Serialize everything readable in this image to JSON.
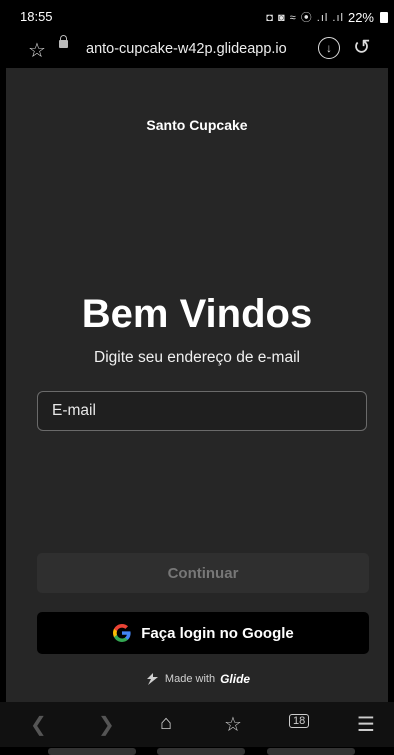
{
  "status": {
    "time": "18:55",
    "battery": "22%",
    "indicator_icons": "◘ ◙ ≈ ⦿ .ıl .ıl"
  },
  "browser": {
    "url": "anto-cupcake-w42p.glideapp.io"
  },
  "app": {
    "brand": "Santo Cupcake",
    "welcome": "Bem Vindos",
    "subtitle": "Digite seu endereço de e-mail",
    "email_placeholder": "E-mail",
    "continue_label": "Continuar",
    "google_label": "Faça login no Google",
    "made_with_prefix": "Made with",
    "made_with_brand": "Glide"
  },
  "nav": {
    "tabs_count": "18"
  },
  "colors": {
    "app_bg": "#262626",
    "google_btn_bg": "#000000",
    "continue_disabled": "#2f2f2f"
  }
}
